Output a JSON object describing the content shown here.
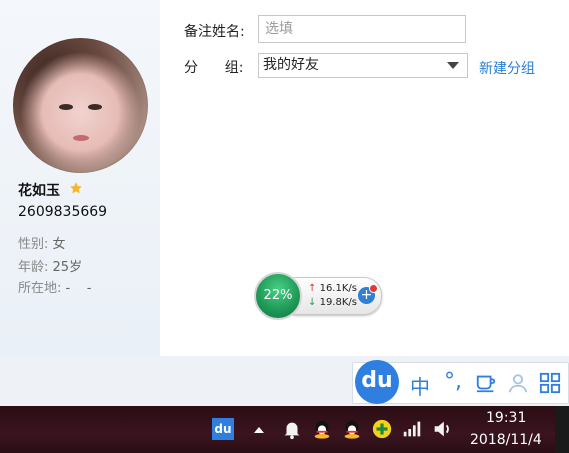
{
  "profile": {
    "name": "花如玉",
    "uid": "2609835669",
    "gender_label": "性别:",
    "gender_value": "女",
    "age_label": "年龄:",
    "age_value": "25岁",
    "location_label": "所在地:",
    "location_value": "-    -"
  },
  "form": {
    "remark_label": "备注姓名:",
    "remark_placeholder": "选填",
    "group_label": "分      组:",
    "group_value": "我的好友",
    "new_group_link": "新建分组"
  },
  "speed_widget": {
    "percent": "22%",
    "upload": "16.1K/s",
    "download": "19.8K/s"
  },
  "ime": {
    "logo": "du",
    "mode": "中",
    "punct": "°,"
  },
  "taskbar": {
    "du_label": "du",
    "time": "19:31",
    "date": "2018/11/4"
  },
  "colors": {
    "accent_blue": "#2f7fe0",
    "link_blue": "#2a7fd2",
    "speed_green": "#1f9c58",
    "taskbar_bg": "#3a1420"
  }
}
